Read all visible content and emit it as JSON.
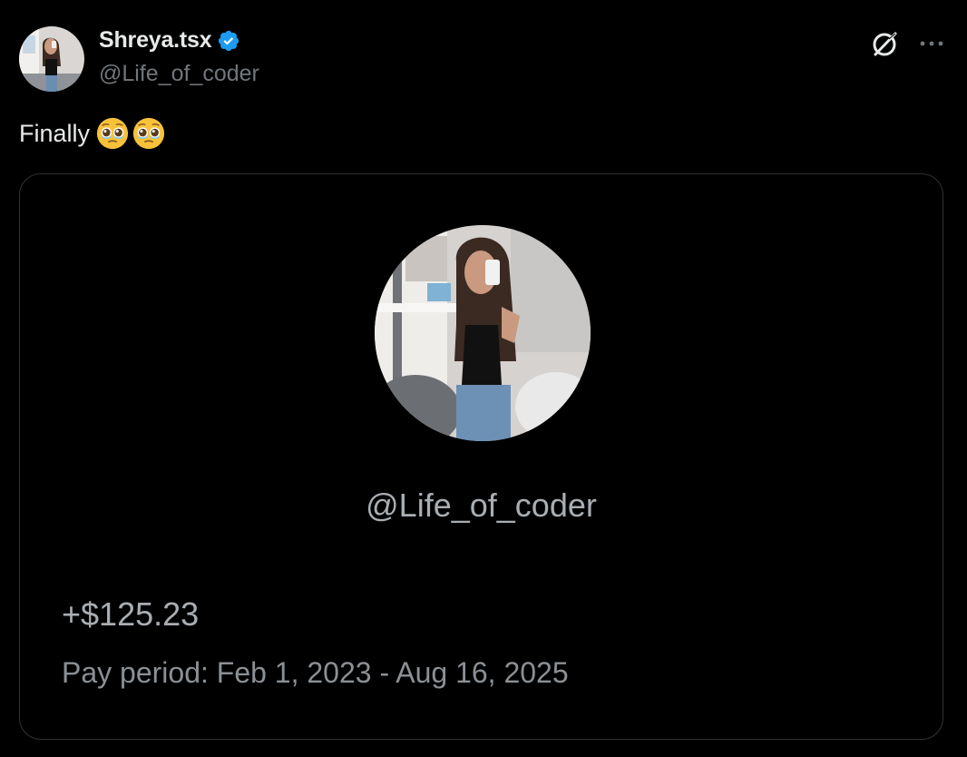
{
  "post": {
    "author": {
      "display_name": "Shreya.tsx",
      "handle": "@Life_of_coder",
      "verified": true,
      "avatar_icon": "profile-photo"
    },
    "text": "Finally",
    "emojis": [
      "pleading-face-with-tears",
      "pleading-face-with-tears"
    ],
    "actions": {
      "grok_icon": "grok-icon",
      "more_icon": "more-horizontal-icon"
    }
  },
  "card": {
    "handle": "@Life_of_coder",
    "amount": "+$125.23",
    "pay_period": "Pay period: Feb 1, 2023 - Aug 16, 2025"
  },
  "colors": {
    "background": "#000000",
    "primary_text": "#e7e9ea",
    "secondary_text": "#71767b",
    "verified_blue": "#1d9bf0",
    "card_border": "#2f3336"
  }
}
